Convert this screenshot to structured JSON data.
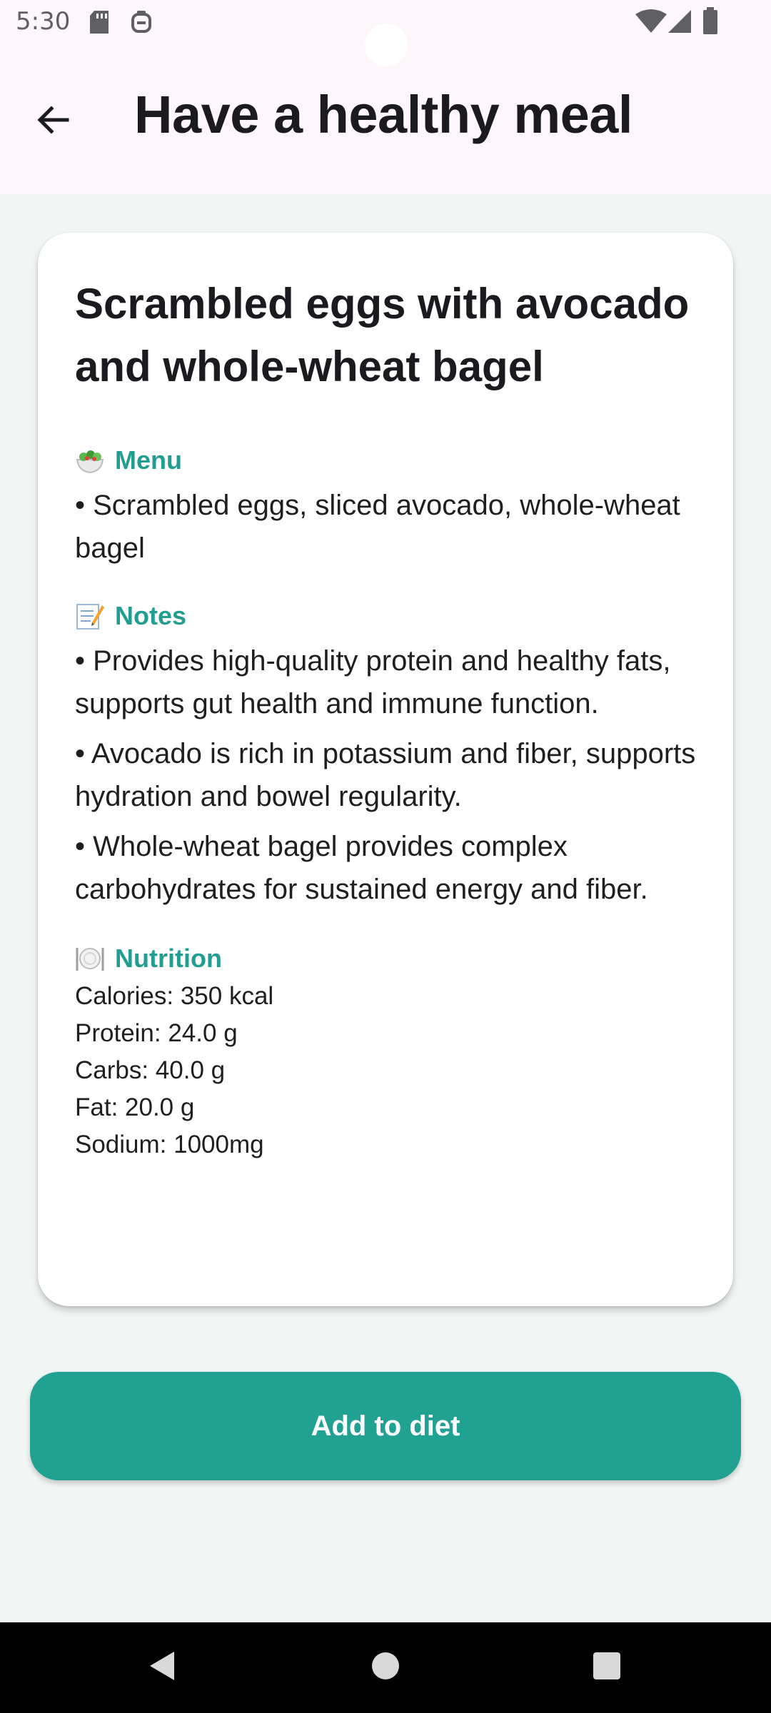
{
  "status_bar": {
    "time": "5:30",
    "icons": [
      "sd-card-icon",
      "notification-icon",
      "wifi-icon",
      "signal-icon",
      "battery-icon"
    ]
  },
  "app_bar": {
    "back_icon": "arrow-back-icon",
    "title": "Have a healthy meal"
  },
  "meal": {
    "title": "Scrambled eggs with avocado and whole-wheat bagel",
    "menu": {
      "icon": "salad-icon",
      "heading": "Menu",
      "items": [
        "• Scrambled eggs, sliced avocado, whole-wheat bagel"
      ]
    },
    "notes": {
      "icon": "memo-icon",
      "heading": "Notes",
      "items": [
        "• Provides high-quality protein and healthy fats, supports gut health and immune function.",
        "• Avocado is rich in potassium and fiber, supports hydration and bowel regularity.",
        "• Whole-wheat bagel provides complex carbohydrates for sustained energy and fiber."
      ]
    },
    "nutrition": {
      "icon": "plate-icon",
      "heading": "Nutrition",
      "lines": [
        "Calories: 350 kcal",
        "Protein: 24.0 g",
        "Carbs: 40.0 g",
        "Fat: 20.0 g",
        "Sodium: 1000mg"
      ]
    }
  },
  "actions": {
    "add_label": "Add to diet"
  },
  "colors": {
    "accent": "#21a192",
    "section_heading": "#229e90",
    "app_bar_bg": "#fdf6fb",
    "page_bg": "#f1f5f4"
  }
}
